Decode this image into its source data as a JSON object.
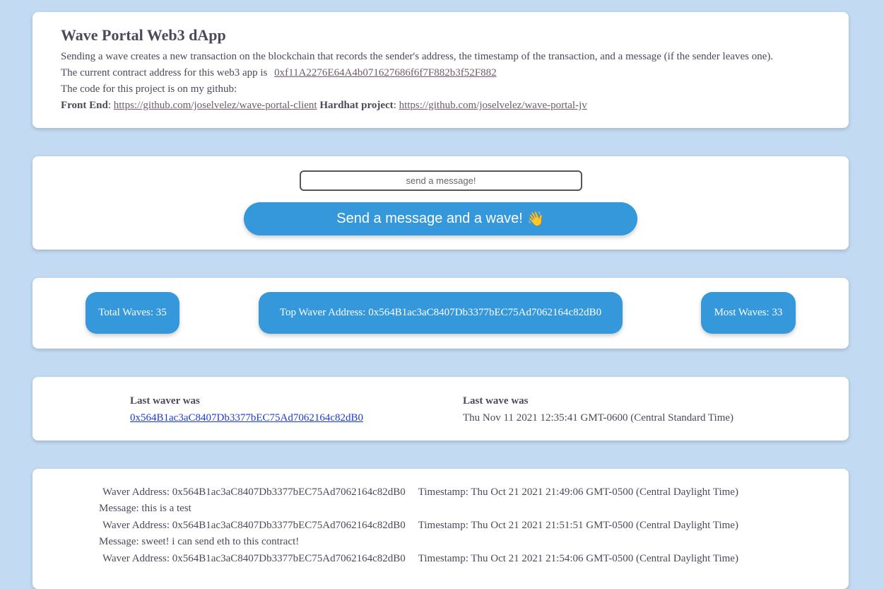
{
  "header": {
    "title": "Wave Portal Web3 dApp",
    "description": "Sending a wave creates a new transaction on the blockchain that records the sender's address, the timestamp of the transaction, and a message (if the sender leaves one).",
    "contract_prefix": "The current contract address for this web3 app is",
    "contract_address": "0xf11A2276E64A4b071627686f6f7F882b3f52F882",
    "code_text": "The code for this project is on my github:",
    "front_end_label": "Front End",
    "front_end_url": "https://github.com/joselvelez/wave-portal-client",
    "hardhat_label": "Hardhat project",
    "hardhat_url": "https://github.com/joselvelez/wave-portal-jv"
  },
  "send": {
    "input_placeholder": "send a message!",
    "input_value": "",
    "button_label": "Send a message and a wave!",
    "button_emoji": "👋"
  },
  "stats": {
    "total_waves": "Total Waves: 35",
    "top_waver": "Top Waver Address: 0x564B1ac3aC8407Db3377bEC75Ad7062164c82dB0",
    "most_waves": "Most Waves: 33"
  },
  "last": {
    "waver_label": "Last waver was",
    "waver_address": "0x564B1ac3aC8407Db3377bEC75Ad7062164c82dB0",
    "wave_label": "Last wave was",
    "wave_time": "Thu Nov 11 2021 12:35:41 GMT-0600 (Central Standard Time)"
  },
  "entries": [
    {
      "address": "Waver Address: 0x564B1ac3aC8407Db3377bEC75Ad7062164c82dB0",
      "timestamp": "Timestamp: Thu Oct 21 2021 21:49:06 GMT-0500 (Central Daylight Time)",
      "message": "Message: this is a test"
    },
    {
      "address": "Waver Address: 0x564B1ac3aC8407Db3377bEC75Ad7062164c82dB0",
      "timestamp": "Timestamp: Thu Oct 21 2021 21:51:51 GMT-0500 (Central Daylight Time)",
      "message": "Message: sweet! i can send eth to this contract!"
    },
    {
      "address": "Waver Address: 0x564B1ac3aC8407Db3377bEC75Ad7062164c82dB0",
      "timestamp": "Timestamp: Thu Oct 21 2021 21:54:06 GMT-0500 (Central Daylight Time)",
      "message": ""
    }
  ],
  "colors": {
    "background": "#c2dbf2",
    "accent": "#3498db",
    "card": "#ffffff",
    "link": "#6f5a6a",
    "link_blue": "#1a3adb"
  }
}
